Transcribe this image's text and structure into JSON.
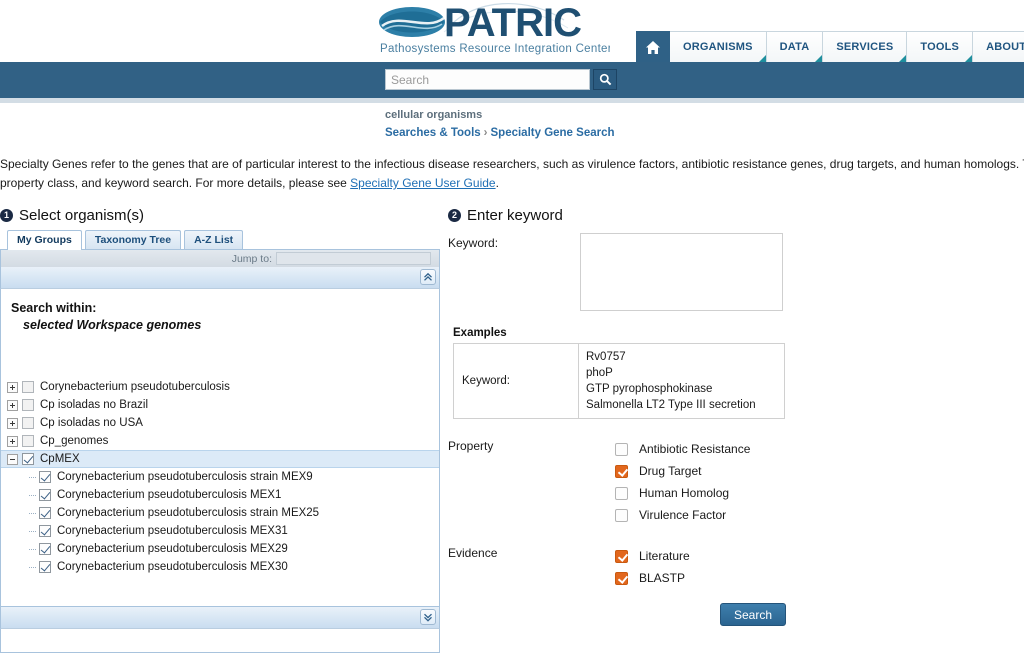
{
  "brand": {
    "name": "PATRIC",
    "tagline": "Pathosystems Resource Integration Center",
    "logo_icon": "patric-swoosh-logo"
  },
  "nav": {
    "home_icon": "home-icon",
    "items": [
      {
        "label": "ORGANISMS"
      },
      {
        "label": "DATA"
      },
      {
        "label": "SERVICES"
      },
      {
        "label": "TOOLS"
      },
      {
        "label": "ABOUT"
      }
    ]
  },
  "search": {
    "placeholder": "Search",
    "value": "",
    "button_icon": "search-icon"
  },
  "breadcrumb": {
    "organism": "cellular organisms",
    "parent": "Searches & Tools",
    "separator": "›",
    "current": "Specialty Gene Search"
  },
  "description": {
    "line1": "Specialty Genes refer to the genes that are of particular interest to the infectious disease researchers, such as virulence factors, antibiotic resistance genes, drug targets, and human homologs. This s",
    "line2_pre": "property class, and keyword search. For more details, please see ",
    "link": "Specialty Gene User Guide",
    "line2_post": "."
  },
  "organism_panel": {
    "step_number": "1",
    "title": "Select organism(s)",
    "tabs": [
      {
        "label": "My Groups",
        "active": true
      },
      {
        "label": "Taxonomy Tree",
        "active": false
      },
      {
        "label": "A-Z List",
        "active": false
      }
    ],
    "jump_to_label": "Jump to:",
    "jump_to_value": "",
    "scroll_up_icon": "double-chevron-up-icon",
    "scroll_down_icon": "double-chevron-down-icon",
    "search_within_label": "Search within:",
    "search_within_value": "selected Workspace genomes",
    "tree": [
      {
        "label": "Corynebacterium pseudotuberculosis",
        "checked": false,
        "expanded": false,
        "selected": false,
        "child": false
      },
      {
        "label": "Cp isoladas no Brazil",
        "checked": false,
        "expanded": false,
        "selected": false,
        "child": false
      },
      {
        "label": "Cp isoladas no USA",
        "checked": false,
        "expanded": false,
        "selected": false,
        "child": false
      },
      {
        "label": "Cp_genomes",
        "checked": false,
        "expanded": false,
        "selected": false,
        "child": false
      },
      {
        "label": "CpMEX",
        "checked": true,
        "expanded": true,
        "selected": true,
        "child": false
      },
      {
        "label": "Corynebacterium pseudotuberculosis strain MEX9",
        "checked": true,
        "child": true
      },
      {
        "label": "Corynebacterium pseudotuberculosis MEX1",
        "checked": true,
        "child": true
      },
      {
        "label": "Corynebacterium pseudotuberculosis strain MEX25",
        "checked": true,
        "child": true
      },
      {
        "label": "Corynebacterium pseudotuberculosis MEX31",
        "checked": true,
        "child": true
      },
      {
        "label": "Corynebacterium pseudotuberculosis MEX29",
        "checked": true,
        "child": true
      },
      {
        "label": "Corynebacterium pseudotuberculosis MEX30",
        "checked": true,
        "child": true
      }
    ]
  },
  "keyword_panel": {
    "step_number": "2",
    "title": "Enter keyword",
    "keyword_label": "Keyword:",
    "keyword_value": "",
    "examples_title": "Examples",
    "examples_key_label": "Keyword:",
    "examples_values": [
      "Rv0757",
      "phoP",
      "GTP pyrophosphokinase",
      "Salmonella LT2 Type III secretion"
    ],
    "property_label": "Property",
    "property_options": [
      {
        "label": "Antibiotic Resistance",
        "checked": false
      },
      {
        "label": "Drug Target",
        "checked": true
      },
      {
        "label": "Human Homolog",
        "checked": false
      },
      {
        "label": "Virulence Factor",
        "checked": false
      }
    ],
    "evidence_label": "Evidence",
    "evidence_options": [
      {
        "label": "Literature",
        "checked": true
      },
      {
        "label": "BLASTP",
        "checked": true
      }
    ],
    "search_button": "Search"
  },
  "colors": {
    "band_blue": "#316185",
    "nav_link": "#1f5480",
    "checkbox_orange": "#e2671d",
    "link_blue": "#1f6fb5",
    "tab_border": "#a8c3dd"
  }
}
